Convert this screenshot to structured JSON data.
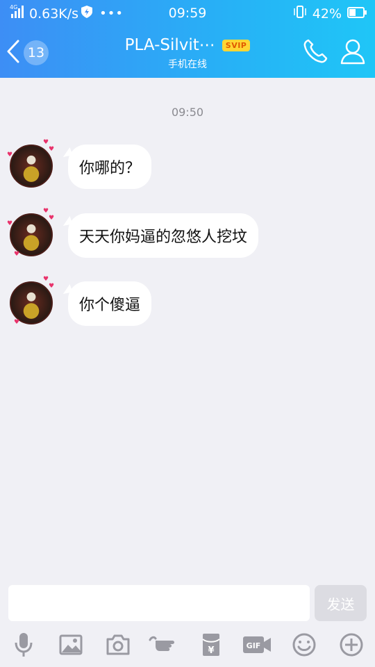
{
  "statusbar": {
    "network": "4G",
    "speed": "0.63K/s",
    "time": "09:59",
    "battery": "42%"
  },
  "nav": {
    "unread": "13",
    "title": "PLA-Silvit⋯",
    "vip_badge": "SVIP",
    "subtitle": "手机在线"
  },
  "chat": {
    "timestamp": "09:50",
    "messages": [
      {
        "text": "你哪的？"
      },
      {
        "text": "天天你妈逼的忽悠人挖坟"
      },
      {
        "text": "你个傻逼"
      }
    ]
  },
  "composer": {
    "input_value": "",
    "send_label": "发送"
  },
  "toolbar": [
    {
      "icon": "microphone-icon"
    },
    {
      "icon": "image-icon"
    },
    {
      "icon": "camera-icon"
    },
    {
      "icon": "poke-hand-icon"
    },
    {
      "icon": "red-packet-icon"
    },
    {
      "icon": "gif-icon"
    },
    {
      "icon": "emoji-icon"
    },
    {
      "icon": "plus-icon"
    }
  ],
  "colors": {
    "header_start": "#3d8ef5",
    "header_end": "#1fc6f7",
    "background": "#f0f0f5",
    "vip": "#ffd633"
  }
}
